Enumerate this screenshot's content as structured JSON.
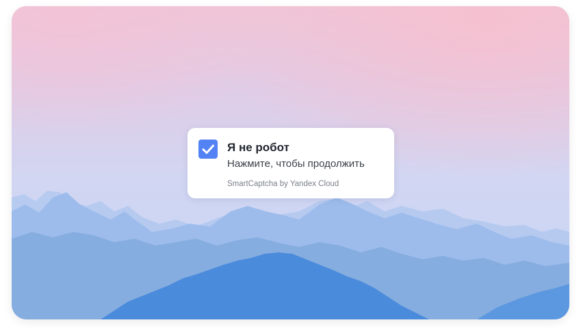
{
  "captcha": {
    "checkbox_state": "checked",
    "title": "Я не робот",
    "subtitle": "Нажмите, чтобы продолжить",
    "brand": "SmartCaptcha by Yandex Cloud"
  },
  "colors": {
    "checkbox_bg": "#5282f3",
    "sky_top": "#f3c6d6",
    "sky_bottom": "#c9d6f5",
    "mountain_front": "#4f8ee0"
  },
  "icons": {
    "checkbox": "checkmark-icon"
  }
}
